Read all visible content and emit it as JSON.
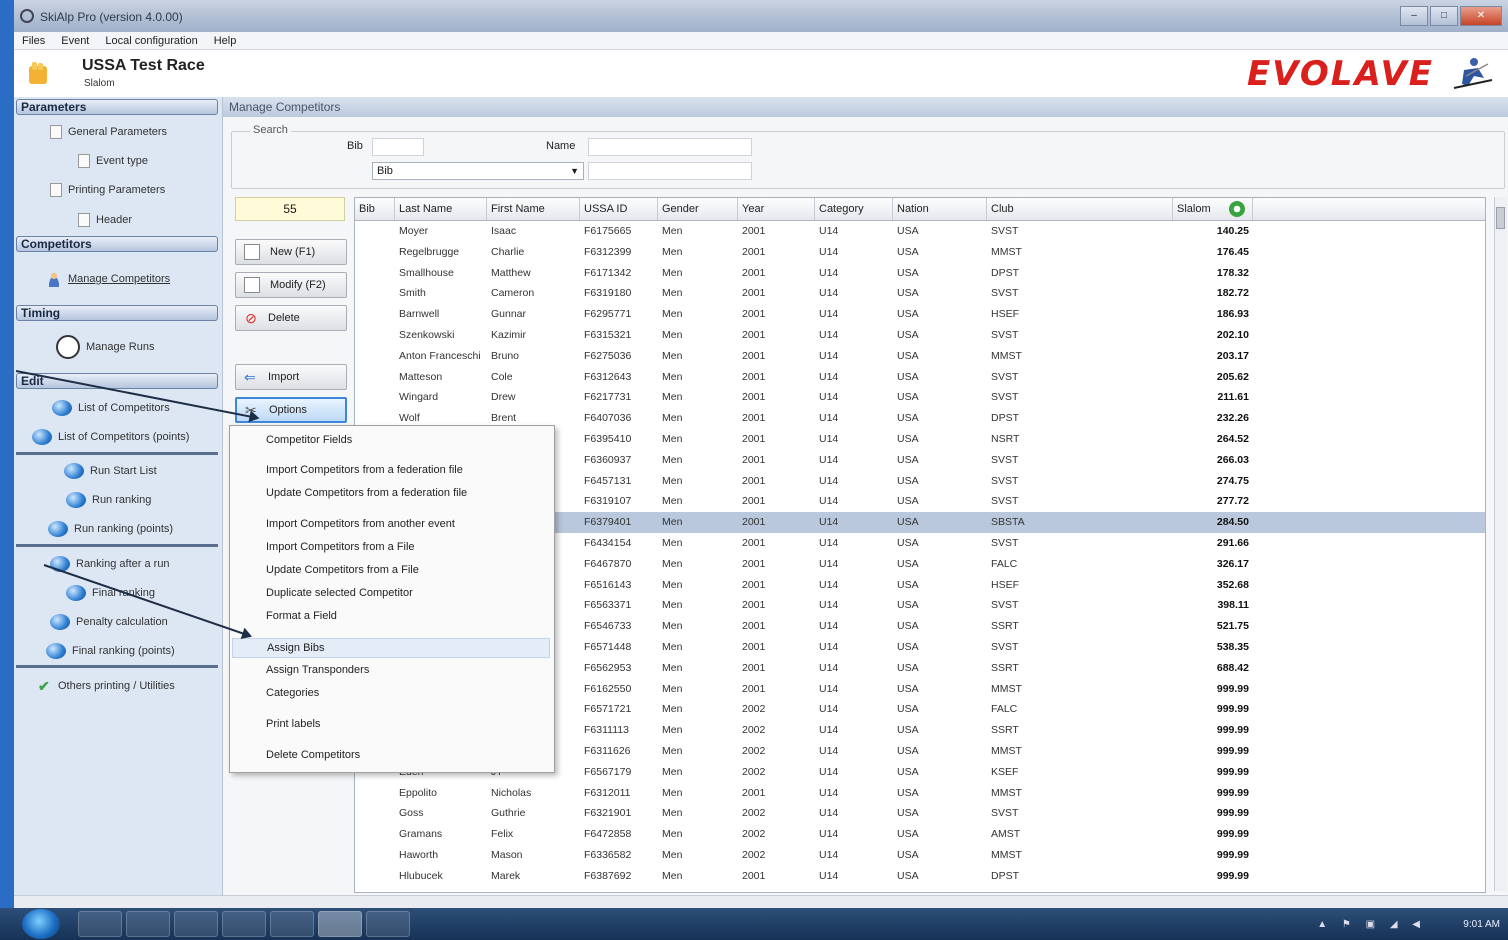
{
  "window": {
    "title": "SkiAlp Pro (version 4.0.00)",
    "controls": {
      "minimize": "–",
      "maximize": "□",
      "close": "✕"
    }
  },
  "menubar": [
    "Files",
    "Event",
    "Local configuration",
    "Help"
  ],
  "header": {
    "race_title": "USSA Test Race",
    "race_subtitle": "Slalom",
    "logo_text": "EVOLAVE",
    "logo_color": "#d9201c"
  },
  "sidebar": {
    "parameters": {
      "title": "Parameters",
      "items": [
        "General Parameters",
        "Event type",
        "Printing Parameters",
        "Header"
      ]
    },
    "competitors": {
      "title": "Competitors",
      "items": [
        "Manage Competitors"
      ]
    },
    "timing": {
      "title": "Timing",
      "items": [
        "Manage Runs"
      ]
    },
    "edit": {
      "title": "Edit",
      "items": [
        "List of Competitors",
        "List of Competitors (points)",
        "Run Start List",
        "Run ranking",
        "Run ranking (points)",
        "Ranking after a run",
        "Final ranking",
        "Penalty calculation",
        "Final ranking (points)",
        "Others printing / Utilities"
      ]
    }
  },
  "main": {
    "panel_title": "Manage Competitors",
    "search": {
      "legend": "Search",
      "bib_label": "Bib",
      "name_label": "Name",
      "bib_value": "",
      "name_value": "",
      "sort_select": "Bib",
      "extra_value": ""
    },
    "count": "55",
    "buttons": {
      "new": "New (F1)",
      "modify": "Modify (F2)",
      "delete": "Delete",
      "import": "Import",
      "options": "Options"
    }
  },
  "table": {
    "columns": [
      "Bib",
      "Last Name",
      "First Name",
      "USSA ID",
      "Gender",
      "Year",
      "Category",
      "Nation",
      "Club",
      "Slalom"
    ],
    "rows": [
      [
        "",
        "Moyer",
        "Isaac",
        "F6175665",
        "Men",
        "2001",
        "U14",
        "USA",
        "SVST",
        "140.25"
      ],
      [
        "",
        "Regelbrugge",
        "Charlie",
        "F6312399",
        "Men",
        "2001",
        "U14",
        "USA",
        "MMST",
        "176.45"
      ],
      [
        "",
        "Smallhouse",
        "Matthew",
        "F6171342",
        "Men",
        "2001",
        "U14",
        "USA",
        "DPST",
        "178.32"
      ],
      [
        "",
        "Smith",
        "Cameron",
        "F6319180",
        "Men",
        "2001",
        "U14",
        "USA",
        "SVST",
        "182.72"
      ],
      [
        "",
        "Barnwell",
        "Gunnar",
        "F6295771",
        "Men",
        "2001",
        "U14",
        "USA",
        "HSEF",
        "186.93"
      ],
      [
        "",
        "Szenkowski",
        "Kazimir",
        "F6315321",
        "Men",
        "2001",
        "U14",
        "USA",
        "SVST",
        "202.10"
      ],
      [
        "",
        "Anton Franceschi",
        "Bruno",
        "F6275036",
        "Men",
        "2001",
        "U14",
        "USA",
        "MMST",
        "203.17"
      ],
      [
        "",
        "Matteson",
        "Cole",
        "F6312643",
        "Men",
        "2001",
        "U14",
        "USA",
        "SVST",
        "205.62"
      ],
      [
        "",
        "Wingard",
        "Drew",
        "F6217731",
        "Men",
        "2001",
        "U14",
        "USA",
        "SVST",
        "211.61"
      ],
      [
        "",
        "Wolf",
        "Brent",
        "F6407036",
        "Men",
        "2001",
        "U14",
        "USA",
        "DPST",
        "232.26"
      ],
      [
        "",
        "",
        "",
        "F6395410",
        "Men",
        "2001",
        "U14",
        "USA",
        "NSRT",
        "264.52"
      ],
      [
        "",
        "",
        "",
        "F6360937",
        "Men",
        "2001",
        "U14",
        "USA",
        "SVST",
        "266.03"
      ],
      [
        "",
        "",
        "",
        "F6457131",
        "Men",
        "2001",
        "U14",
        "USA",
        "SVST",
        "274.75"
      ],
      [
        "",
        "",
        "",
        "F6319107",
        "Men",
        "2001",
        "U14",
        "USA",
        "SVST",
        "277.72"
      ],
      [
        "",
        "",
        "",
        "F6379401",
        "Men",
        "2001",
        "U14",
        "USA",
        "SBSTA",
        "284.50"
      ],
      [
        "",
        "",
        "",
        "F6434154",
        "Men",
        "2001",
        "U14",
        "USA",
        "SVST",
        "291.66"
      ],
      [
        "",
        "",
        "",
        "F6467870",
        "Men",
        "2001",
        "U14",
        "USA",
        "FALC",
        "326.17"
      ],
      [
        "",
        "",
        "",
        "F6516143",
        "Men",
        "2001",
        "U14",
        "USA",
        "HSEF",
        "352.68"
      ],
      [
        "",
        "",
        "",
        "F6563371",
        "Men",
        "2001",
        "U14",
        "USA",
        "SVST",
        "398.11"
      ],
      [
        "",
        "",
        "",
        "F6546733",
        "Men",
        "2001",
        "U14",
        "USA",
        "SSRT",
        "521.75"
      ],
      [
        "",
        "",
        "",
        "F6571448",
        "Men",
        "2001",
        "U14",
        "USA",
        "SVST",
        "538.35"
      ],
      [
        "",
        "",
        "",
        "F6562953",
        "Men",
        "2001",
        "U14",
        "USA",
        "SSRT",
        "688.42"
      ],
      [
        "",
        "",
        "",
        "F6162550",
        "Men",
        "2001",
        "U14",
        "USA",
        "MMST",
        "999.99"
      ],
      [
        "",
        "",
        "",
        "F6571721",
        "Men",
        "2002",
        "U14",
        "USA",
        "FALC",
        "999.99"
      ],
      [
        "",
        "",
        "",
        "F6311113",
        "Men",
        "2002",
        "U14",
        "USA",
        "SSRT",
        "999.99"
      ],
      [
        "",
        "",
        "",
        "F6311626",
        "Men",
        "2002",
        "U14",
        "USA",
        "MMST",
        "999.99"
      ],
      [
        "",
        "Eden",
        "JT",
        "F6567179",
        "Men",
        "2002",
        "U14",
        "USA",
        "KSEF",
        "999.99"
      ],
      [
        "",
        "Eppolito",
        "Nicholas",
        "F6312011",
        "Men",
        "2001",
        "U14",
        "USA",
        "MMST",
        "999.99"
      ],
      [
        "",
        "Goss",
        "Guthrie",
        "F6321901",
        "Men",
        "2002",
        "U14",
        "USA",
        "SVST",
        "999.99"
      ],
      [
        "",
        "Gramans",
        "Felix",
        "F6472858",
        "Men",
        "2002",
        "U14",
        "USA",
        "AMST",
        "999.99"
      ],
      [
        "",
        "Haworth",
        "Mason",
        "F6336582",
        "Men",
        "2002",
        "U14",
        "USA",
        "MMST",
        "999.99"
      ],
      [
        "",
        "Hlubucek",
        "Marek",
        "F6387692",
        "Men",
        "2001",
        "U14",
        "USA",
        "DPST",
        "999.99"
      ]
    ],
    "selected_row": 14
  },
  "context_menu": {
    "items": [
      "Competitor Fields",
      "Import Competitors from a federation file",
      "Update Competitors from a federation file",
      "Import Competitors from another event",
      "Import Competitors from a File",
      "Update Competitors from a File",
      "Duplicate selected Competitor",
      "Format a Field",
      "Assign Bibs",
      "Assign Transponders",
      "Categories",
      "Print labels",
      "Delete Competitors"
    ],
    "highlighted": 8
  },
  "taskbar": {
    "clock": "9:01 AM"
  }
}
